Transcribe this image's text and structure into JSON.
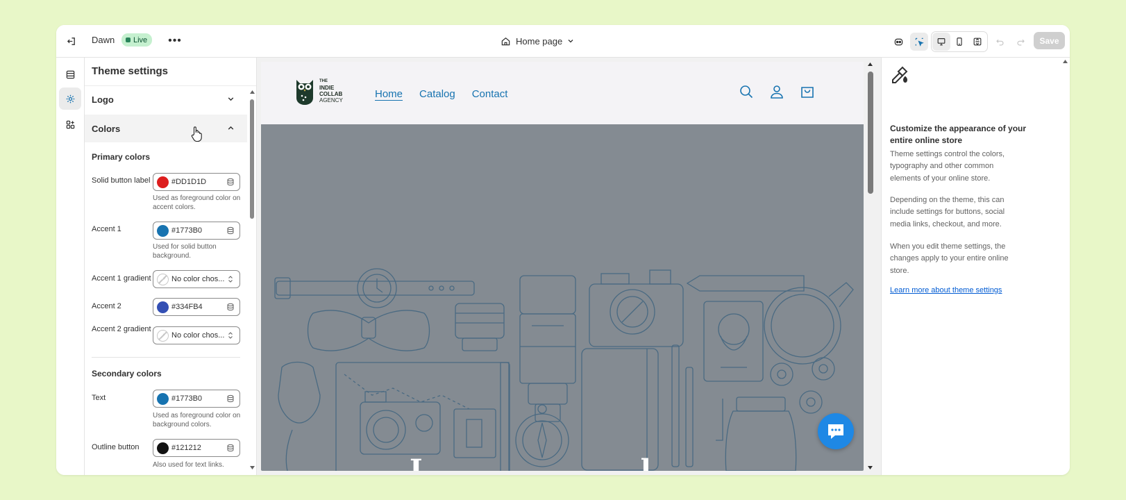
{
  "topbar": {
    "theme_name": "Dawn",
    "status_badge": "Live",
    "more_label": "•••",
    "page_selector": "Home page",
    "save_label": "Save"
  },
  "panel": {
    "title": "Theme settings",
    "sections": [
      {
        "label": "Logo",
        "state": "collapsed"
      },
      {
        "label": "Colors",
        "state": "expanded"
      }
    ],
    "primary_heading": "Primary colors",
    "secondary_heading": "Secondary colors",
    "rows": [
      {
        "label": "Solid button label",
        "value": "#DD1D1D",
        "color": "#DD1D1D",
        "help": "Used as foreground color on accent colors.",
        "kind": "color"
      },
      {
        "label": "Accent 1",
        "value": "#1773B0",
        "color": "#1773B0",
        "help": "Used for solid button background.",
        "kind": "color"
      },
      {
        "label": "Accent 1 gradient",
        "value": "No color chos...",
        "color": "",
        "help": "",
        "kind": "gradient"
      },
      {
        "label": "Accent 2",
        "value": "#334FB4",
        "color": "#334FB4",
        "help": "",
        "kind": "color"
      },
      {
        "label": "Accent 2 gradient",
        "value": "No color chos...",
        "color": "",
        "help": "",
        "kind": "gradient"
      },
      {
        "label": "Text",
        "value": "#1773B0",
        "color": "#1773B0",
        "help": "Used as foreground color on background colors.",
        "kind": "color"
      },
      {
        "label": "Outline button",
        "value": "#121212",
        "color": "#121212",
        "help": "Also used for text links.",
        "kind": "color"
      }
    ]
  },
  "store": {
    "logo_lines": [
      "THE",
      "INDIE",
      "COLLAB",
      "AGENCY"
    ],
    "nav": [
      "Home",
      "Catalog",
      "Contact"
    ],
    "hero_text": "I l"
  },
  "info": {
    "heading": "Customize the appearance of your entire online store",
    "paragraphs": [
      "Theme settings control the colors, typography and other common elements of your online store.",
      "Depending on the theme, this can include settings for buttons, social media links, checkout, and more.",
      "When you edit theme settings, the changes apply to your entire online store."
    ],
    "link": "Learn more about theme settings"
  },
  "colors": {
    "brand_accent": "#1773B0",
    "live_badge_bg": "#C5F0CF",
    "hero_bg": "#848B92",
    "chat_bg": "#1E88E5"
  }
}
